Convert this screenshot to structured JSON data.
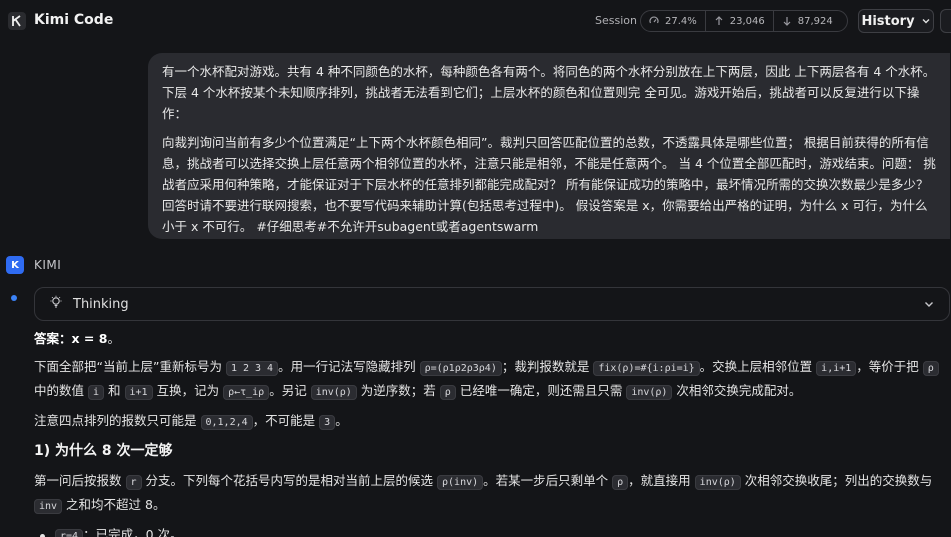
{
  "header": {
    "app_title": "Kimi Code",
    "session_label": "Session",
    "stats": {
      "usage": "27.4%",
      "input_tokens": "23,046",
      "output_tokens": "87,924"
    },
    "history_label": "History"
  },
  "user_message": {
    "paragraph1": "有一个水杯配对游戏。共有 4 种不同颜色的水杯，每种颜色各有两个。将同色的两个水杯分别放在上下两层，因此 上下两层各有 4 个水杯。下层 4 个水杯按某个未知顺序排列，挑战者无法看到它们；上层水杯的颜色和位置则完 全可见。游戏开始后，挑战者可以反复进行以下操作：",
    "paragraph2": "向裁判询问当前有多少个位置满足“上下两个水杯颜色相同”。裁判只回答匹配位置的总数，不透露具体是哪些位置； 根据目前获得的所有信息，挑战者可以选择交换上层任意两个相邻位置的水杯，注意只能是相邻，不能是任意两个。 当 4 个位置全部匹配时，游戏结束。问题： 挑战者应采用何种策略，才能保证对于下层水杯的任意排列都能完成配对？ 所有能保证成功的策略中，最坏情况所需的交换次数最少是多少？ 回答时请不要进行联网搜索，也不要写代码来辅助计算(包括思考过程中)。 假设答案是 x，你需要给出严格的证明，为什么 x 可行，为什么小于 x 不可行。 #仔细思考#不允许开subagent或者agentswarm"
  },
  "assistant": {
    "avatar_letter": "K",
    "name": "KIMI",
    "thinking_label": "Thinking",
    "answer_prefix": "答案：",
    "answer_value": "x = 8",
    "answer_suffix": "。",
    "p1": {
      "t1": "下面全部把“当前上层”重新标号为",
      "c1": "1 2 3 4",
      "t2": "。用一行记法写隐藏排列",
      "c2": "ρ=(ρ1ρ2ρ3ρ4)",
      "t3": "；裁判报数就是",
      "c3": "fix(ρ)=#{i:ρi=i}",
      "t4": "。交换上层相邻位置",
      "c4": "i,i+1",
      "t5": "，等价于把",
      "c5": "ρ",
      "t6": "中的数值",
      "c6": "i",
      "t7": "和",
      "c7": "i+1",
      "t8": "互换，记为",
      "c8": "ρ←τ_iρ",
      "t9": "。另记",
      "c9": "inv(ρ)",
      "t10": "为逆序数；若",
      "c10": "ρ",
      "t11": "已经唯一确定，则还需且只需",
      "c11": "inv(ρ)",
      "t12": "次相邻交换完成配对。"
    },
    "p2": {
      "t1": "注意四点排列的报数只可能是",
      "c1": "0,1,2,4",
      "t2": "，不可能是",
      "c2": "3",
      "t3": "。"
    },
    "heading1": "1) 为什么 8 次一定够",
    "p3": {
      "t1": "第一问后按报数",
      "c1": "r",
      "t2": "分支。下列每个花括号内写的是相对当前上层的候选",
      "c2": "ρ(inv)",
      "t3": "。若某一步后只剩单个",
      "c3": "ρ",
      "t4": "，就直接用",
      "c4": "inv(ρ)",
      "t5": "次相邻交换收尾；列出的交换数与",
      "c5": "inv",
      "t6": "之和均不超过 8。"
    },
    "bullet1": {
      "code": "r=4",
      "text": "：已完成，0 次。"
    }
  }
}
